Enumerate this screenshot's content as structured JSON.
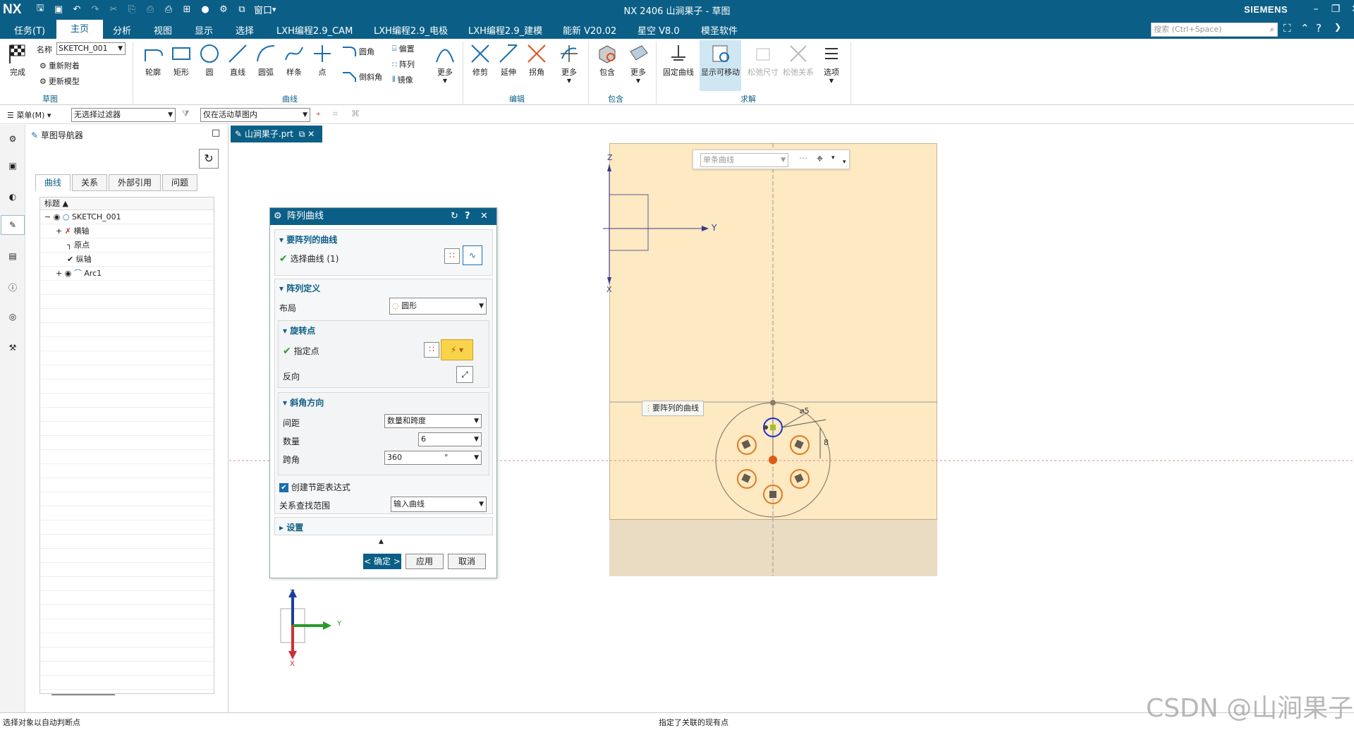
{
  "titlebar": {
    "logo": "NX",
    "title": "NX 2406 山涧果子 - 草图",
    "brand": "SIEMENS",
    "window_menu": "窗口"
  },
  "menu": {
    "items": [
      "任务(T)",
      "主页",
      "分析",
      "视图",
      "显示",
      "选择",
      "LXH编程2.9_CAM",
      "LXH编程2.9_电极",
      "LXH编程2.9_建模",
      "能新 V20.02",
      "星空 V8.0",
      "模圣软件"
    ],
    "search_placeholder": "搜索 (Ctrl+Space)"
  },
  "ribbon": {
    "finish": "完成",
    "name_label": "名称",
    "name_value": "SKETCH_001",
    "reattach": "重新附着",
    "update_model": "更新模型",
    "group_sketch": "草图",
    "curve_buttons": [
      "轮廓",
      "矩形",
      "圆",
      "直线",
      "圆弧",
      "样条",
      "点"
    ],
    "fillet": "圆角",
    "chamfer": "倒斜角",
    "offset": "偏置",
    "pattern": "阵列",
    "mirror": "镜像",
    "more": "更多",
    "group_curve": "曲线",
    "edit_buttons": [
      "修剪",
      "延伸",
      "拐角"
    ],
    "group_edit": "编辑",
    "include": "包含",
    "group_include": "包含",
    "fix_curve": "固定曲线",
    "show_movable": "显示可移动",
    "relax_dim": "松弛尺寸",
    "relax_rel": "松弛关系",
    "options": "选项",
    "group_solve": "求解"
  },
  "filterbar": {
    "menu": "菜单(M)",
    "filter": "无选择过滤器",
    "scope": "仅在活动草图内"
  },
  "navigator": {
    "title": "草图导航器",
    "tabs": [
      "曲线",
      "关系",
      "外部引用",
      "问题"
    ],
    "column": "标题",
    "rows": [
      {
        "label": "SKETCH_001"
      },
      {
        "label": "横轴"
      },
      {
        "label": "原点"
      },
      {
        "label": "纵轴"
      },
      {
        "label": "Arc1"
      }
    ]
  },
  "graphics": {
    "tab": "山涧果子.prt",
    "curve_rule": "单条曲线",
    "tooltip": "要阵列的曲线",
    "dim_diameter": "⌀5",
    "dim_distance": "8",
    "axis_z": "Z",
    "axis_y": "Y",
    "axis_x": "X"
  },
  "dialog": {
    "title": "阵列曲线",
    "sec_curves": "要阵列的曲线",
    "select_curve": "选择曲线 (1)",
    "sec_define": "阵列定义",
    "layout_label": "布局",
    "layout_value": "圆形",
    "sec_rotation": "旋转点",
    "specify_point": "指定点",
    "reverse": "反向",
    "sec_angle": "斜角方向",
    "spacing_label": "间距",
    "spacing_value": "数量和跨度",
    "count_label": "数量",
    "count_value": "6",
    "span_label": "跨角",
    "span_value": "360",
    "span_unit": "°",
    "create_expr": "创建节距表达式",
    "relation_label": "关系查找范围",
    "relation_value": "输入曲线",
    "sec_settings": "设置",
    "ok": "< 确定 >",
    "apply": "应用",
    "cancel": "取消"
  },
  "status": {
    "left": "选择对象以自动判断点",
    "center": "指定了关联的现有点"
  },
  "watermark": "CSDN @山涧果子"
}
